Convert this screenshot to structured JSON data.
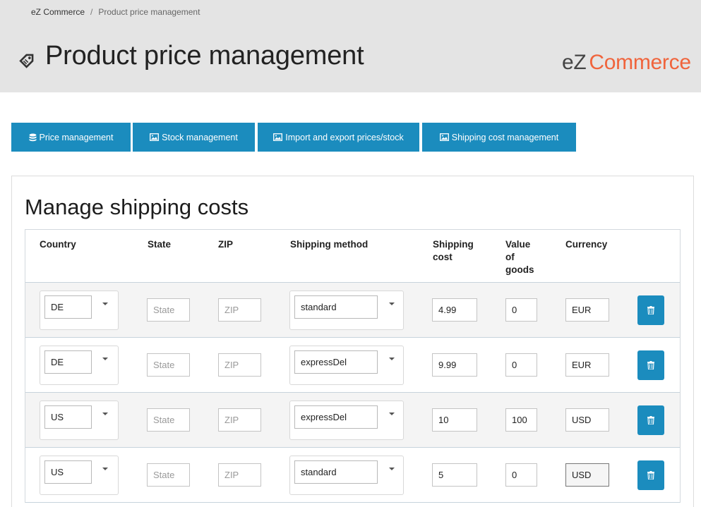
{
  "breadcrumb": {
    "home": "eZ Commerce",
    "separator": "/",
    "current": "Product price management"
  },
  "header": {
    "title": "Product price management",
    "logo_ez": "eZ",
    "logo_commerce": "Commerce",
    "icon": "price-tag-icon"
  },
  "tabs": [
    {
      "label": "Price management",
      "icon": "database-icon"
    },
    {
      "label": "Stock management",
      "icon": "image-icon"
    },
    {
      "label": "Import and export prices/stock",
      "icon": "image-icon"
    },
    {
      "label": "Shipping cost management",
      "icon": "image-icon"
    }
  ],
  "panel": {
    "title": "Manage shipping costs"
  },
  "table": {
    "headers": {
      "country": "Country",
      "state": "State",
      "zip": "ZIP",
      "shipping_method": "Shipping method",
      "shipping_cost_1": "Shipping",
      "shipping_cost_2": "cost",
      "value_1": "Value",
      "value_2": "of",
      "value_3": "goods",
      "currency": "Currency"
    },
    "rows": [
      {
        "country": "DE",
        "state_placeholder": "State",
        "zip_placeholder": "ZIP",
        "method": "standard",
        "cost": "4.99",
        "value": "0",
        "currency": "EUR"
      },
      {
        "country": "DE",
        "state_placeholder": "State",
        "zip_placeholder": "ZIP",
        "method": "expressDel",
        "cost": "9.99",
        "value": "0",
        "currency": "EUR"
      },
      {
        "country": "US",
        "state_placeholder": "State",
        "zip_placeholder": "ZIP",
        "method": "expressDel",
        "cost": "10",
        "value": "100",
        "currency": "USD"
      },
      {
        "country": "US",
        "state_placeholder": "State",
        "zip_placeholder": "ZIP",
        "method": "standard",
        "cost": "5",
        "value": "0",
        "currency": "USD"
      }
    ]
  },
  "colors": {
    "accent": "#1b8cbe",
    "logo_orange": "#f0643c",
    "header_bg": "#e4e4e4"
  }
}
